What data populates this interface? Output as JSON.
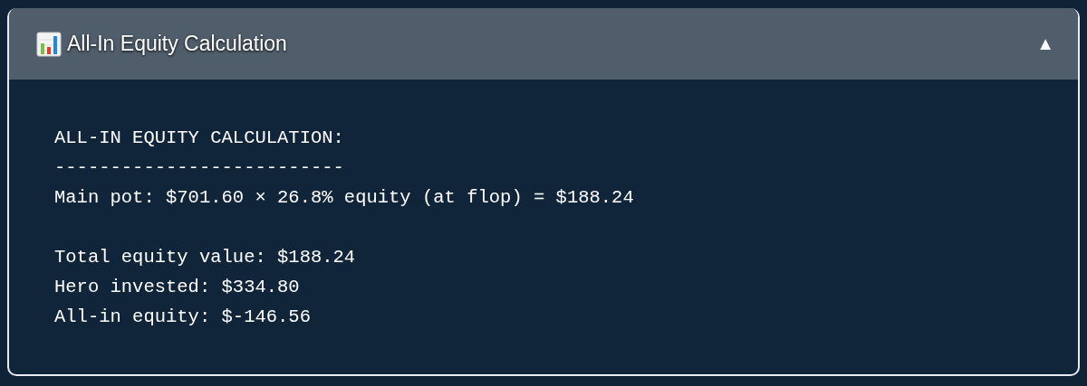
{
  "panel": {
    "title": "All-In Equity Calculation",
    "toggle": "▲",
    "blocks": [
      [
        "ALL-IN EQUITY CALCULATION:",
        "--------------------------",
        "Main pot: $701.60 × 26.8% equity (at flop) = $188.24"
      ],
      [
        "Total equity value: $188.24",
        "Hero invested: $334.80",
        "All-in equity: $-146.56"
      ]
    ]
  }
}
